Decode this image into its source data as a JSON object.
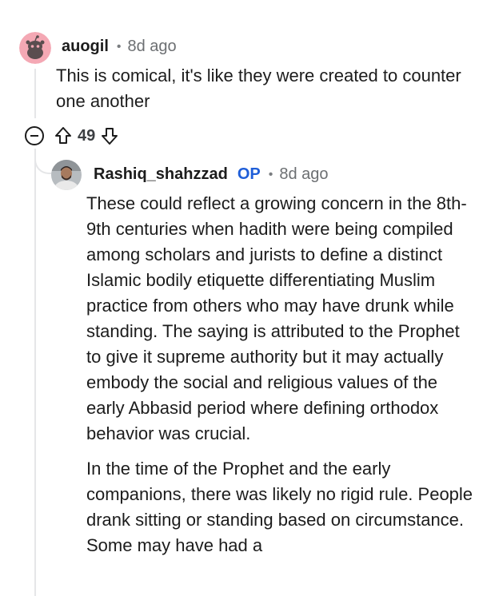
{
  "comments": [
    {
      "username": "auogil",
      "dot": "•",
      "time": "8d ago",
      "body": "This is comical, it's like they were created to counter one another",
      "score": "49",
      "avatar_icon": "reddit-snoo-avatar-icon"
    },
    {
      "username": "Rashiq_shahzzad",
      "badge": "OP",
      "dot": "•",
      "time": "8d ago",
      "avatar_icon": "user-photo-avatar",
      "paragraphs": [
        "These could reflect a growing concern in the 8th-9th centuries when hadith were being compiled among scholars and jurists to define a distinct Islamic bodily etiquette differentiating Muslim practice from others who may have drunk while standing. The saying is attributed to the Prophet to give it supreme authority but it may actually embody the social and religious values of the early Abbasid period where defining orthodox behavior was crucial.",
        "In the time of the Prophet and the early companions, there was likely no rigid rule. People drank sitting or standing based on circumstance. Some may have had a"
      ]
    }
  ],
  "colors": {
    "op_badge": "#1f5ed8",
    "thread_line": "#e5e6e8",
    "avatar_1_bg": "#f4a8b4"
  }
}
